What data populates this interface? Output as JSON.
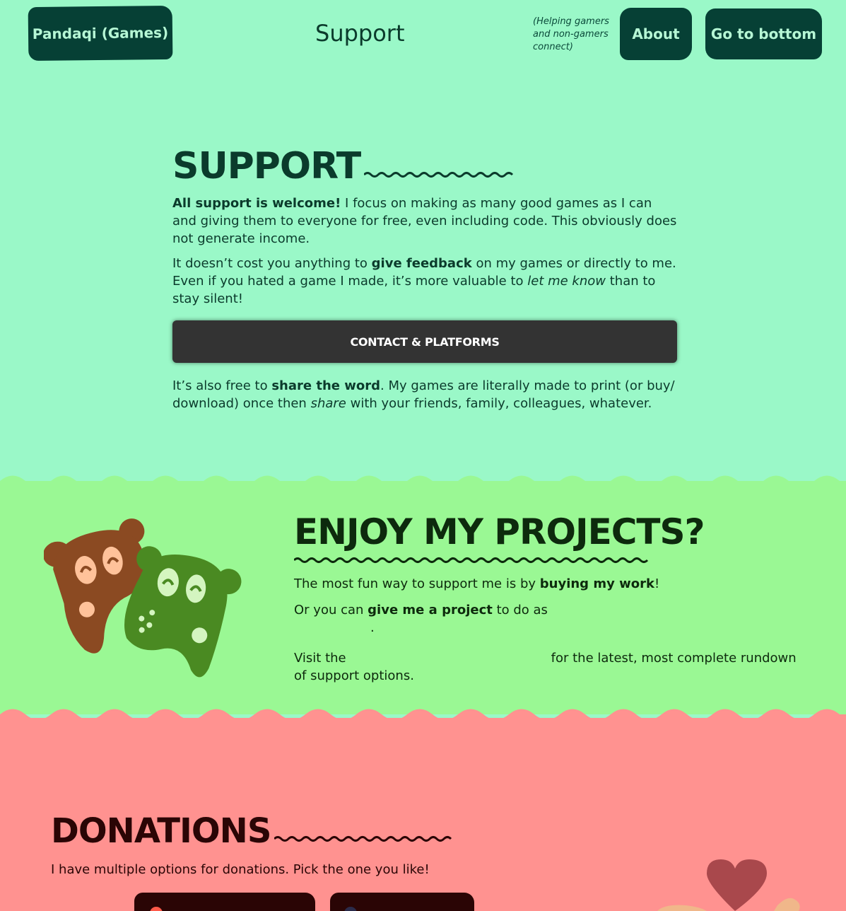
{
  "header": {
    "logo_label": "Pandaqi (Games)",
    "page_title": "Support",
    "tagline": "(Helping gamers and non-gamers connect)",
    "nav_about": "About",
    "nav_bottom": "Go to bottom"
  },
  "support": {
    "heading": "SUPPORT",
    "p1_bold": "All support is welcome!",
    "p1_rest": " I focus on making as many good games as I can and giving them to everyone for free, even including code. This obviously does not generate income.",
    "p2_a": "It doesn’t cost you anything to ",
    "p2_b": "give feedback",
    "p2_c": " on my games or directly to me. Even if you hated a game I made, it’s more valuable to ",
    "p2_d": "let me know",
    "p2_e": " than to stay silent!",
    "contact_button": "CONTACT & PLATFORMS",
    "p3_a": "It’s also free to ",
    "p3_b": "share the word",
    "p3_c": ". My games are literally made to print (or buy/ download) once then ",
    "p3_d": "share",
    "p3_e": " with your friends, family, colleagues, whatever."
  },
  "enjoy": {
    "heading": "ENJOY MY PROJECTS?",
    "p1_a": "The most fun way to support me is by ",
    "p1_b": "buying my work",
    "p1_c": "!",
    "p2_a": "Or you can ",
    "p2_b": "give me a project",
    "p2_c": " to do as",
    "p2_end": ".",
    "p3_a": "Visit the",
    "p3_b": "for the latest, most complete rundown of support options."
  },
  "donations": {
    "heading": "DONATIONS",
    "p1": "I have multiple options for donations. Pick the one you like!"
  },
  "colors": {
    "mint_bg": "#9af8c8",
    "green_bg": "#9af894",
    "red_bg": "#ff9290",
    "dark_teal": "#064035"
  }
}
